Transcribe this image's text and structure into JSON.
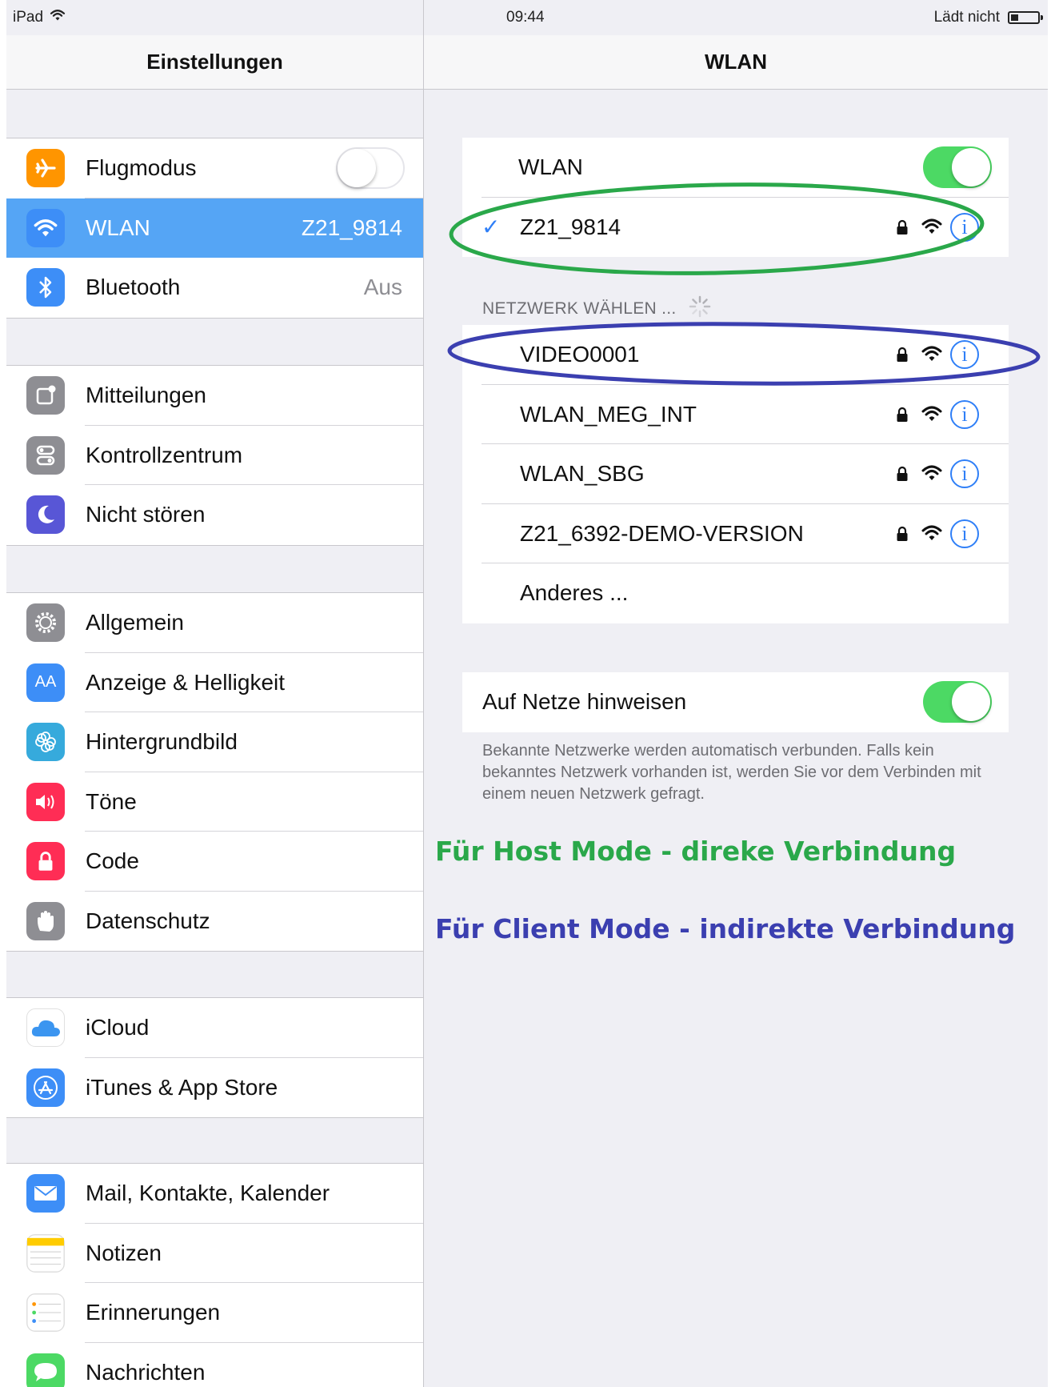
{
  "status_bar": {
    "device": "iPad",
    "time": "09:44",
    "battery_text": "Lädt nicht"
  },
  "master": {
    "title": "Einstellungen",
    "groups": [
      [
        {
          "label": "Flugmodus",
          "icon": "airplane-icon",
          "color": "#ff9500",
          "toggle": false
        },
        {
          "label": "WLAN",
          "value": "Z21_9814",
          "icon": "wifi-icon",
          "color": "#3d8ef7",
          "selected": true
        },
        {
          "label": "Bluetooth",
          "value": "Aus",
          "icon": "bluetooth-icon",
          "color": "#3d8ef7"
        }
      ],
      [
        {
          "label": "Mitteilungen",
          "icon": "notifications-icon",
          "color": "#8e8e93"
        },
        {
          "label": "Kontrollzentrum",
          "icon": "control-center-icon",
          "color": "#8e8e93"
        },
        {
          "label": "Nicht stören",
          "icon": "moon-icon",
          "color": "#5856d6"
        }
      ],
      [
        {
          "label": "Allgemein",
          "icon": "gear-icon",
          "color": "#8e8e93"
        },
        {
          "label": "Anzeige & Helligkeit",
          "icon": "display-icon",
          "color": "#3d8ef7"
        },
        {
          "label": "Hintergrundbild",
          "icon": "wallpaper-icon",
          "color": "#36aadc"
        },
        {
          "label": "Töne",
          "icon": "sound-icon",
          "color": "#ff2d55"
        },
        {
          "label": "Code",
          "icon": "lock-icon",
          "color": "#ff2d55"
        },
        {
          "label": "Datenschutz",
          "icon": "hand-icon",
          "color": "#8e8e93"
        }
      ],
      [
        {
          "label": "iCloud",
          "icon": "icloud-icon",
          "color": "#ffffff"
        },
        {
          "label": "iTunes & App Store",
          "icon": "app-store-icon",
          "color": "#3d8ef7"
        }
      ],
      [
        {
          "label": "Mail, Kontakte, Kalender",
          "icon": "mail-icon",
          "color": "#3d8ef7"
        },
        {
          "label": "Notizen",
          "icon": "notes-icon",
          "color": "#ffffff"
        },
        {
          "label": "Erinnerungen",
          "icon": "reminders-icon",
          "color": "#ffffff"
        },
        {
          "label": "Nachrichten",
          "icon": "messages-icon",
          "color": "#4cd964"
        }
      ]
    ]
  },
  "detail": {
    "title": "WLAN",
    "wlan_label": "WLAN",
    "wlan_on": true,
    "connected": {
      "ssid": "Z21_9814",
      "secured": true
    },
    "choose_header": "NETZWERK WÄHLEN ...",
    "networks": [
      {
        "ssid": "VIDEO0001",
        "secured": true
      },
      {
        "ssid": "WLAN_MEG_INT",
        "secured": true
      },
      {
        "ssid": "WLAN_SBG",
        "secured": true
      },
      {
        "ssid": "Z21_6392-DEMO-VERSION",
        "secured": true
      }
    ],
    "other_label": "Anderes ...",
    "ask_label": "Auf Netze hinweisen",
    "ask_on": true,
    "ask_note": "Bekannte Netzwerke werden automatisch verbunden. Falls kein bekanntes Netzwerk vorhanden ist, werden Sie vor dem Verbinden mit einem neuen Netzwerk gefragt."
  },
  "annotations": {
    "host_mode": "Für Host Mode - direke Verbindung",
    "client_mode": "Für Client Mode - indirekte Verbindung",
    "host_color": "#2aa84a",
    "client_color": "#3b3fb0"
  }
}
